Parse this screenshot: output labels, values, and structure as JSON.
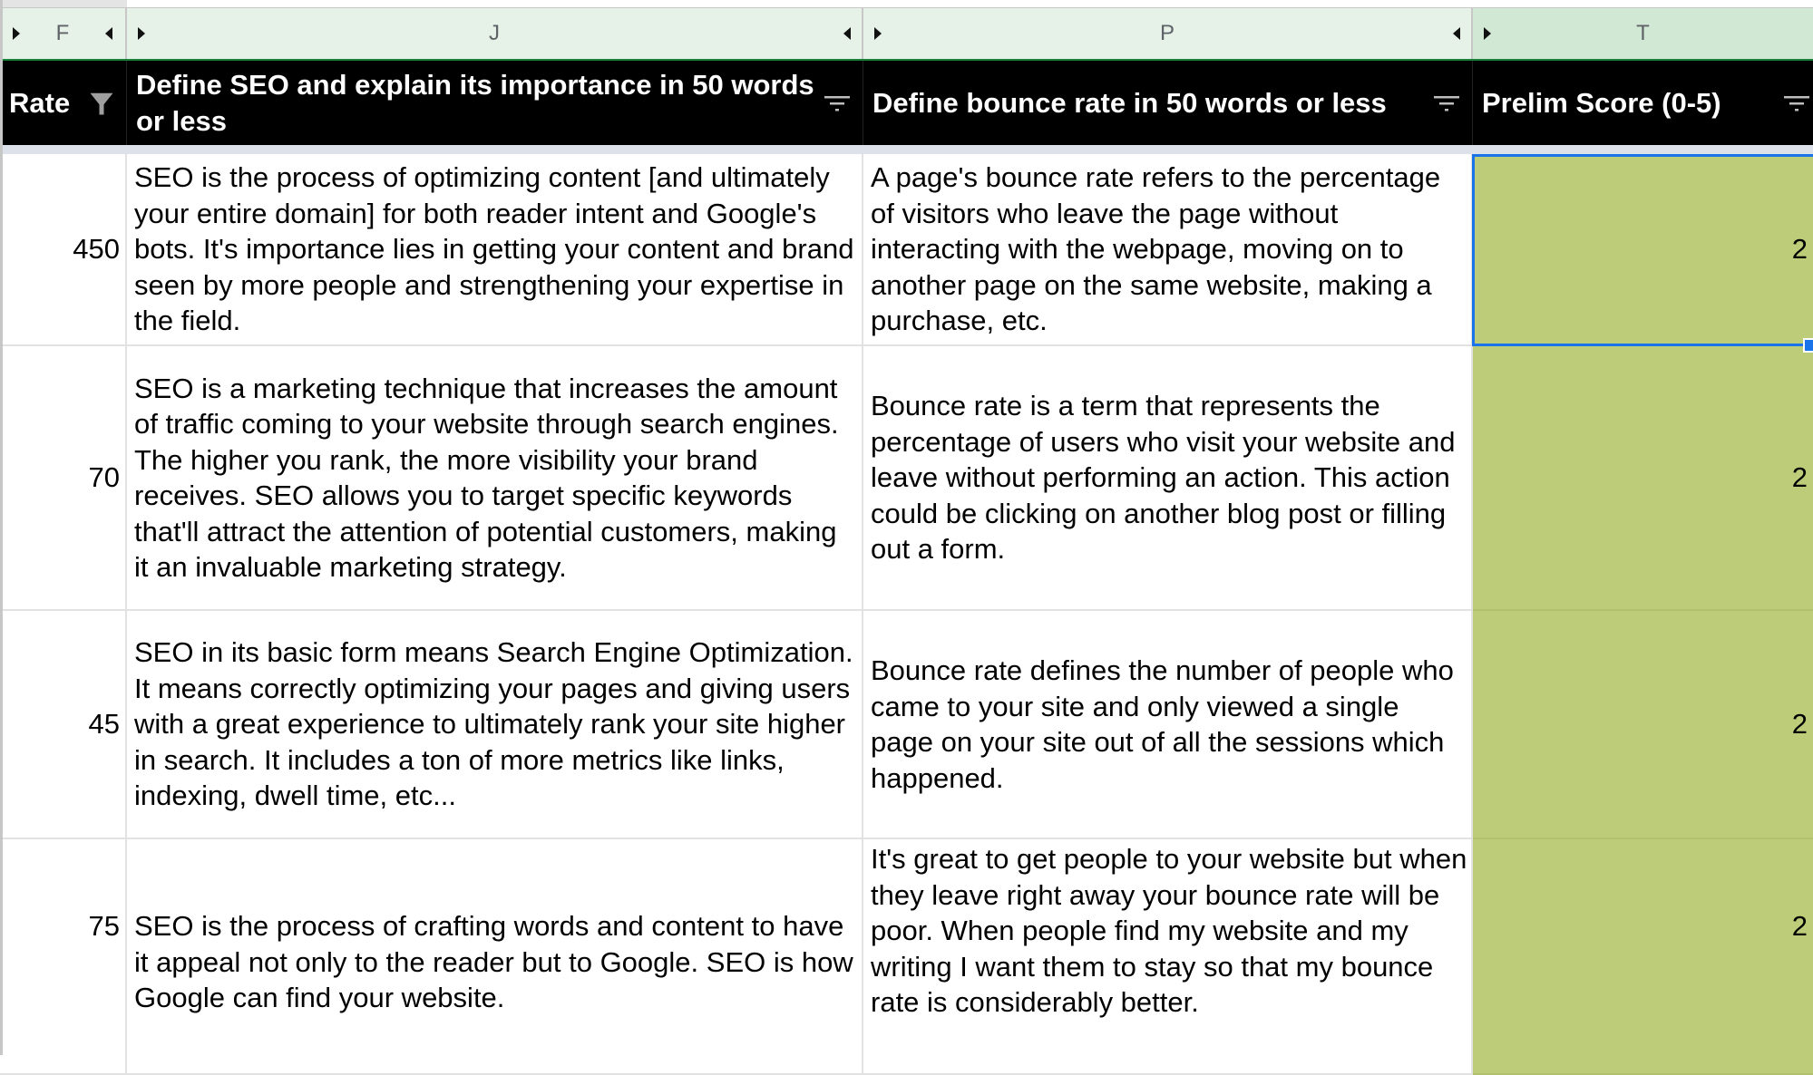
{
  "column_letters": [
    {
      "letter": "F",
      "selected": false
    },
    {
      "letter": "J",
      "selected": false
    },
    {
      "letter": "P",
      "selected": false
    },
    {
      "letter": "T",
      "selected": true
    }
  ],
  "headers": [
    {
      "label": "Rate",
      "filter": "active-filter-icon"
    },
    {
      "label": "Define SEO and explain its importance in 50 words or less",
      "filter": "filter-icon"
    },
    {
      "label": "Define bounce rate in 50 words or less",
      "filter": "filter-icon"
    },
    {
      "label": "Prelim Score (0-5)",
      "filter": "filter-icon"
    }
  ],
  "rows": [
    {
      "rate": "450",
      "seo": "SEO is the process of optimizing content [and ultimately your entire domain] for both reader intent and Google's bots. It's importance lies in getting your content and brand seen by more people and strengthening your expertise in the field.",
      "bounce": "A page's bounce rate refers to the percentage of visitors who leave the page without interacting with the webpage, moving on to another page on the same website, making a purchase, etc.",
      "score": "2"
    },
    {
      "rate": "70",
      "seo": "SEO is a marketing technique that increases the amount of traffic coming to your website through search engines. The higher you rank, the more visibility your brand receives. SEO allows you to target specific keywords that'll attract the attention of potential customers, making it an invaluable marketing strategy.",
      "bounce": "Bounce rate is a term that represents the percentage of users who visit your website and leave without performing an action. This action could be clicking on another blog post or filling out a form.",
      "score": "2"
    },
    {
      "rate": "45",
      "seo": "SEO in its basic form means Search Engine Optimization. It means correctly optimizing your pages and giving users with a great experience to ultimately rank your site higher in search. It includes a ton of more metrics like links, indexing, dwell time, etc...",
      "bounce": "Bounce rate defines the number of people who came to your site and only viewed a single page on your site out of all the sessions which happened.",
      "score": "2"
    },
    {
      "rate": "75",
      "seo": "SEO is the process of crafting words and content to have it appeal not only to the reader but to Google. SEO is how Google can find your website.",
      "bounce": "It's great to get people to your website but when they leave right away your bounce rate will be poor. When people find my website and my writing I want them to stay so that my bounce rate is considerably better.",
      "score": "2"
    }
  ],
  "colors": {
    "header_bg": "#000000",
    "score_fill": "#bccc78",
    "selection": "#1a73e8",
    "column_header_bg": "#e6f2e8",
    "column_header_selected_bg": "#d0e8d4"
  }
}
